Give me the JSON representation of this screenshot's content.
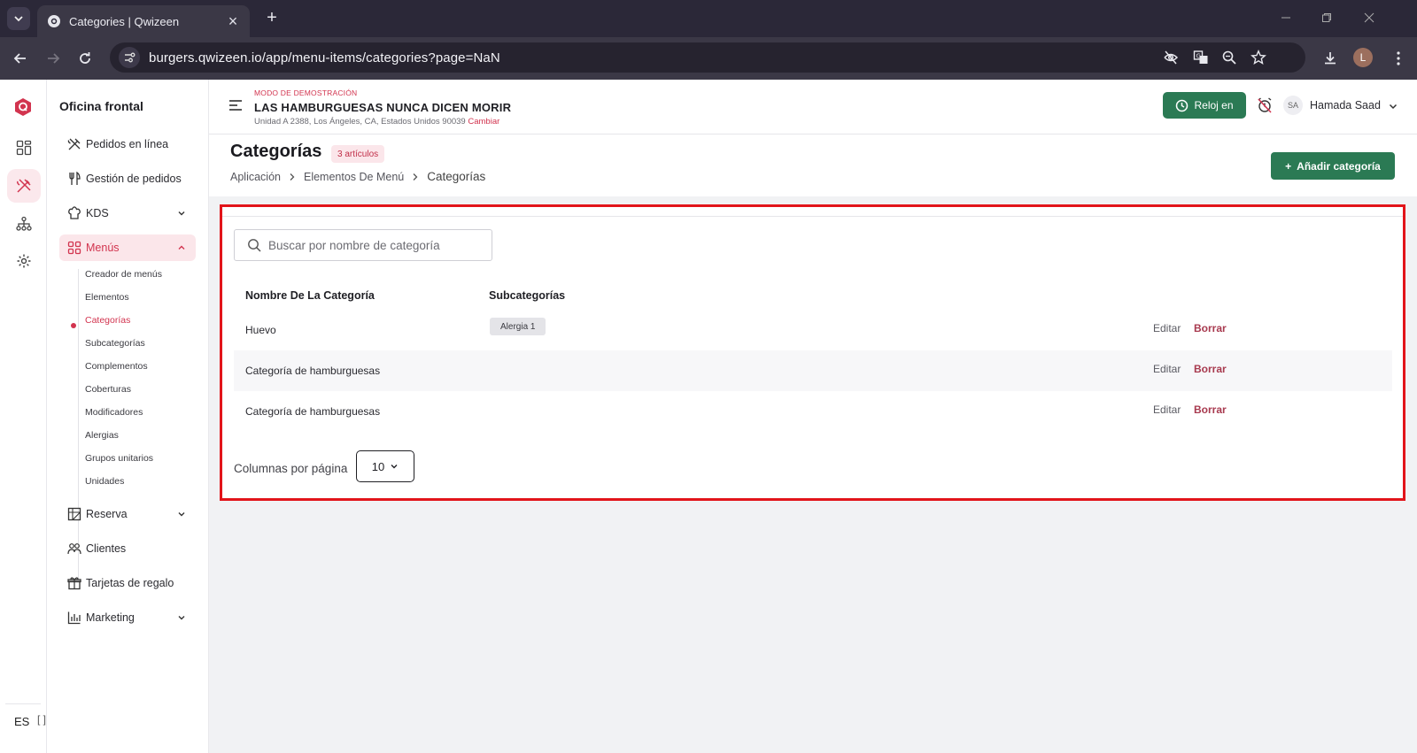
{
  "browser": {
    "tab_title": "Categories | Qwizeen",
    "url": "burgers.qwizeen.io/app/menu-items/categories?page=NaN",
    "profile_initial": "L"
  },
  "rail": {
    "language": "ES",
    "items": [
      "dashboard-icon",
      "fork-knife-icon",
      "network-icon",
      "gear-icon"
    ],
    "accent": "#d2344f"
  },
  "sidebar": {
    "title": "Oficina frontal",
    "items": [
      {
        "label": "Pedidos en línea",
        "icon": "fork-knife-icon"
      },
      {
        "label": "Gestión de pedidos",
        "icon": "utensils-icon"
      },
      {
        "label": "KDS",
        "icon": "chef-hat-icon"
      },
      {
        "label": "Menús",
        "icon": "grid-icon"
      },
      {
        "label": "Reserva",
        "icon": "table-icon"
      },
      {
        "label": "Clientes",
        "icon": "users-icon"
      },
      {
        "label": "Tarjetas de regalo",
        "icon": "gift-icon"
      },
      {
        "label": "Marketing",
        "icon": "bar-chart-icon"
      }
    ],
    "menus_sub": [
      "Creador de menús",
      "Elementos",
      "Categorías",
      "Subcategorías",
      "Complementos",
      "Coberturas",
      "Modificadores",
      "Alergias",
      "Grupos unitarios",
      "Unidades"
    ]
  },
  "header": {
    "demo_label": "MODO DE DEMOSTRACIÓN",
    "restaurant_name": "LAS HAMBURGUESAS NUNCA DICEN MORIR",
    "address": "Unidad A 2388, Los Ángeles, CA, Estados Unidos 90039",
    "change_label": "Cambiar",
    "clock_in_label": "Reloj en",
    "user_initials": "SA",
    "user_name": "Hamada Saad",
    "brand_green": "#2b7a54"
  },
  "page": {
    "title": "Categorías",
    "count_badge": "3 artículos",
    "breadcrumb": [
      "Aplicación",
      "Elementos De Menú",
      "Categorías"
    ],
    "add_button": "Añadir categoría"
  },
  "table": {
    "search_placeholder": "Buscar por nombre de categoría",
    "headers": [
      "Nombre De La Categoría",
      "Subcategorías"
    ],
    "rows": [
      {
        "name": "Huevo",
        "subcategory": "Alergia 1",
        "edit": "Editar",
        "delete": "Borrar"
      },
      {
        "name": "Categoría de hamburguesas",
        "subcategory": "",
        "edit": "Editar",
        "delete": "Borrar"
      },
      {
        "name": "Categoría de hamburguesas",
        "subcategory": "",
        "edit": "Editar",
        "delete": "Borrar"
      }
    ],
    "rows_per_page_label": "Columnas por página",
    "rows_per_page_value": "10"
  }
}
